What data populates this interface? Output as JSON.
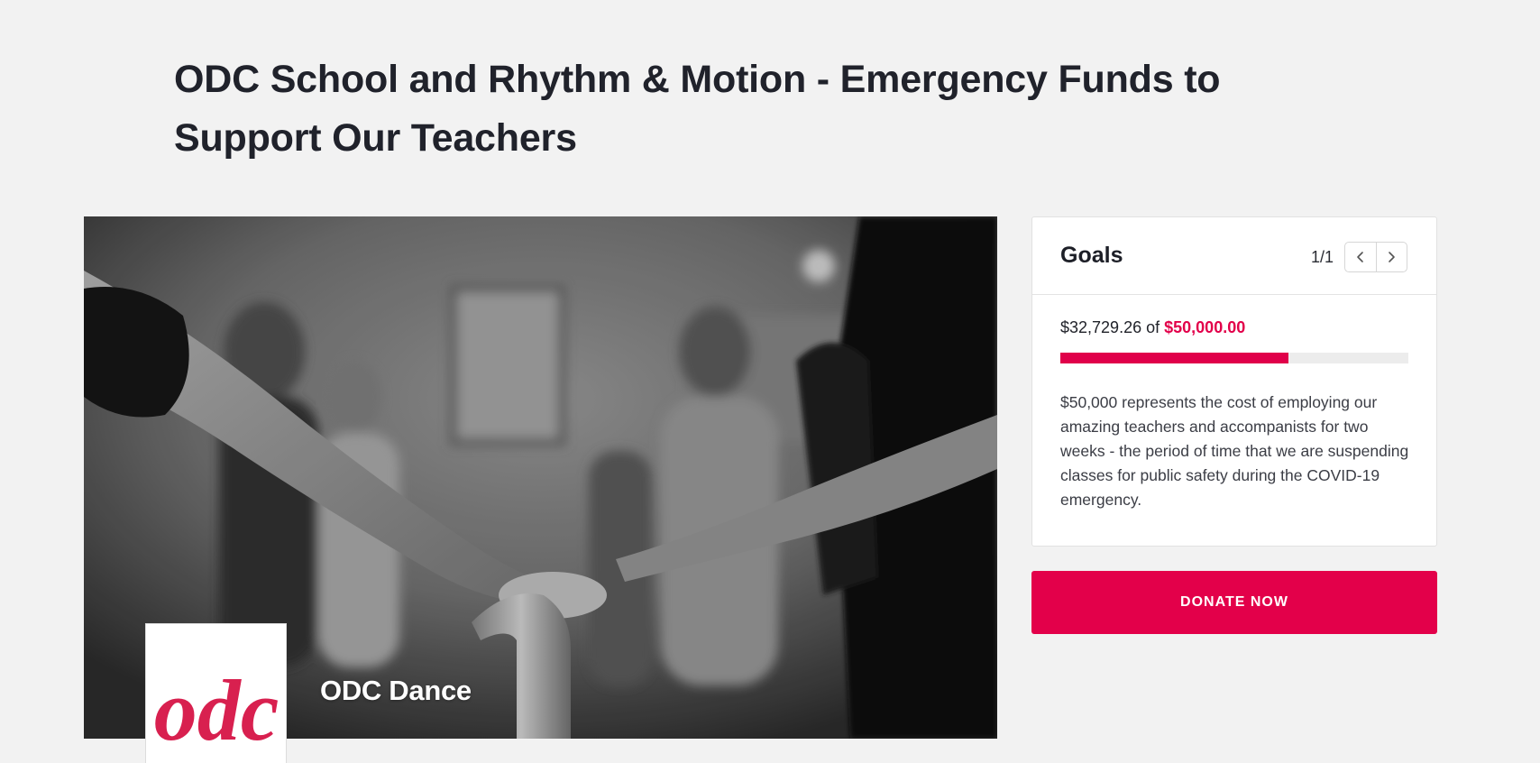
{
  "campaign": {
    "title": "ODC School and Rhythm & Motion - Emergency Funds to Support Our Teachers"
  },
  "hero": {
    "image": "black-and-white photo of dancers holding a ballet barre",
    "org_name": "ODC Dance",
    "logo_text": "odc",
    "logo_color": "#d8204f"
  },
  "goals": {
    "title": "Goals",
    "pager": "1/1",
    "raised": "$32,729.26",
    "of_label": "of",
    "goal": "$50,000.00",
    "progress_percent": 65.46,
    "description": "$50,000 represents the cost of employing our amazing teachers and accompanists for two weeks - the period of time that we are suspending classes for public safety during the COVID-19 emergency.",
    "prev_icon": "chevron-left-icon",
    "next_icon": "chevron-right-icon"
  },
  "donate": {
    "label": "DONATE NOW"
  },
  "colors": {
    "accent": "#e3004a",
    "background": "#f2f2f2",
    "heading": "#20222b"
  }
}
